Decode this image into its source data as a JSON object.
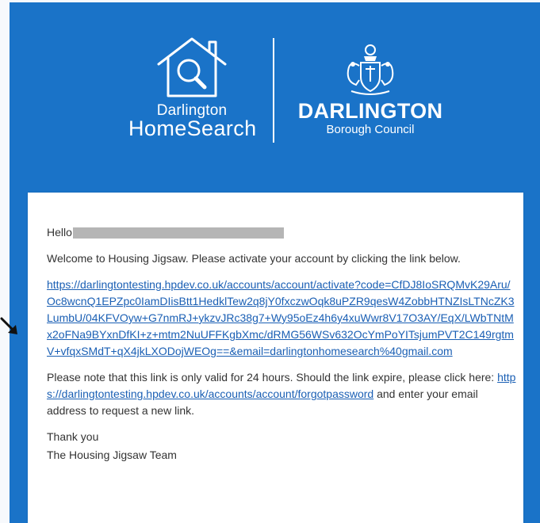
{
  "header": {
    "homesearch_town": "Darlington",
    "homesearch_word": "HomeSearch",
    "council_name": "DARLINGTON",
    "council_sub": "Borough Council"
  },
  "email": {
    "greeting": "Hello",
    "welcome": "Welcome to Housing Jigsaw. Please activate your account by clicking the link below.",
    "activation_link": "https://darlingtontesting.hpdev.co.uk/accounts/account/activate?code=CfDJ8IoSRQMvK29Aru/Oc8wcnQ1EPZpc0IamDIisBtt1HedklTew2q8jY0fxczwOqk8uPZR9qesW4ZobbHTNZIsLTNcZK3LumbU/04KFVOyw+G7nmRJ+ykzvJRc38g7+Wy95oEz4h6y4xuWwr8V17O3AY/EqX/LWbTNtMx2oFNa9BYxnDfKI+z+mtm2NuUFFKgbXmc/dRMG56WSv632OcYmPoYITsjumPVT2C149rgtmV+vfqxSMdT+qX4jkLXODojWEOg==&email=darlingtonhomesearch%40gmail.com",
    "note_before": "Please note that this link is only valid for 24 hours. Should the link expire, please click here: ",
    "forgot_link": "https://darlingtontesting.hpdev.co.uk/accounts/account/forgotpassword",
    "note_after": " and enter your email address to request a new link.",
    "thanks": "Thank you",
    "team": "The Housing Jigsaw Team"
  },
  "colors": {
    "brand_blue": "#1a73c8",
    "link": "#1a5fb4"
  }
}
